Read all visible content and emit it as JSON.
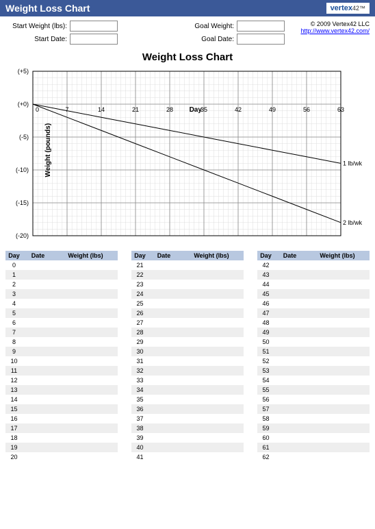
{
  "header": {
    "title": "Weight Loss Chart",
    "logo_main": "vertex",
    "logo_sub": "42"
  },
  "inputs": {
    "start_weight_label": "Start Weight (lbs):",
    "start_date_label": "Start Date:",
    "goal_weight_label": "Goal Weight:",
    "goal_date_label": "Goal Date:",
    "start_weight": "",
    "start_date": "",
    "goal_weight": "",
    "goal_date": ""
  },
  "footer": {
    "copyright": "© 2009 Vertex42 LLC",
    "link": "http://www.vertex42.com/"
  },
  "chart_title": "Weight Loss Chart",
  "chart_data": {
    "type": "line",
    "title": "Weight Loss Chart",
    "xlabel": "Day",
    "ylabel": "Weight (pounds)",
    "x_ticks": [
      0,
      7,
      14,
      21,
      28,
      35,
      42,
      49,
      56,
      63
    ],
    "y_ticks": [
      5,
      0,
      -5,
      -10,
      -15,
      -20
    ],
    "y_tick_labels": [
      "(+5)",
      "(+0)",
      "(-5)",
      "(-10)",
      "(-15)",
      "(-20)"
    ],
    "xlim": [
      0,
      63
    ],
    "ylim": [
      -20,
      5
    ],
    "grid": true,
    "x": [
      0,
      7,
      14,
      21,
      28,
      35,
      42,
      49,
      56,
      63
    ],
    "series": [
      {
        "name": "1 lb/wk",
        "values": [
          0,
          -1,
          -2,
          -3,
          -4,
          -5,
          -6,
          -7,
          -8,
          -9
        ]
      },
      {
        "name": "2 lb/wk",
        "values": [
          0,
          -2,
          -4,
          -6,
          -8,
          -10,
          -12,
          -14,
          -16,
          -18
        ]
      }
    ]
  },
  "table": {
    "headers": {
      "day": "Day",
      "date": "Date",
      "weight": "Weight (lbs)"
    },
    "columns": [
      {
        "start": 0,
        "end": 20
      },
      {
        "start": 21,
        "end": 41
      },
      {
        "start": 42,
        "end": 62
      }
    ]
  }
}
